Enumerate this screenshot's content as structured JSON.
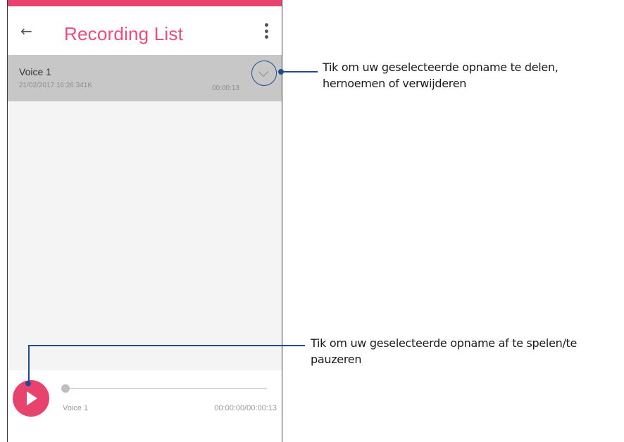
{
  "app": {
    "title": "Recording List"
  },
  "icons": {
    "back": "←",
    "more": "more-vert-icon",
    "expand": "chevron-down-icon",
    "play": "play-icon"
  },
  "colors": {
    "accent": "#ee4d79",
    "callout": "#1f4d8f",
    "selected_row": "#c7c7c7"
  },
  "recording": {
    "name": "Voice 1",
    "meta": "21/02/2017 16:26   341K",
    "duration": "00:00:13"
  },
  "player": {
    "name": "Voice 1",
    "time": "00:00:00/00:00:13",
    "progress": 0
  },
  "callouts": {
    "share_rename_delete": [
      "Tik om uw geselecteerde opname te delen,",
      "hernoemen of verwijderen"
    ],
    "play_pause": [
      "Tik om uw geselecteerde opname af te spelen/te",
      "pauzeren"
    ]
  }
}
